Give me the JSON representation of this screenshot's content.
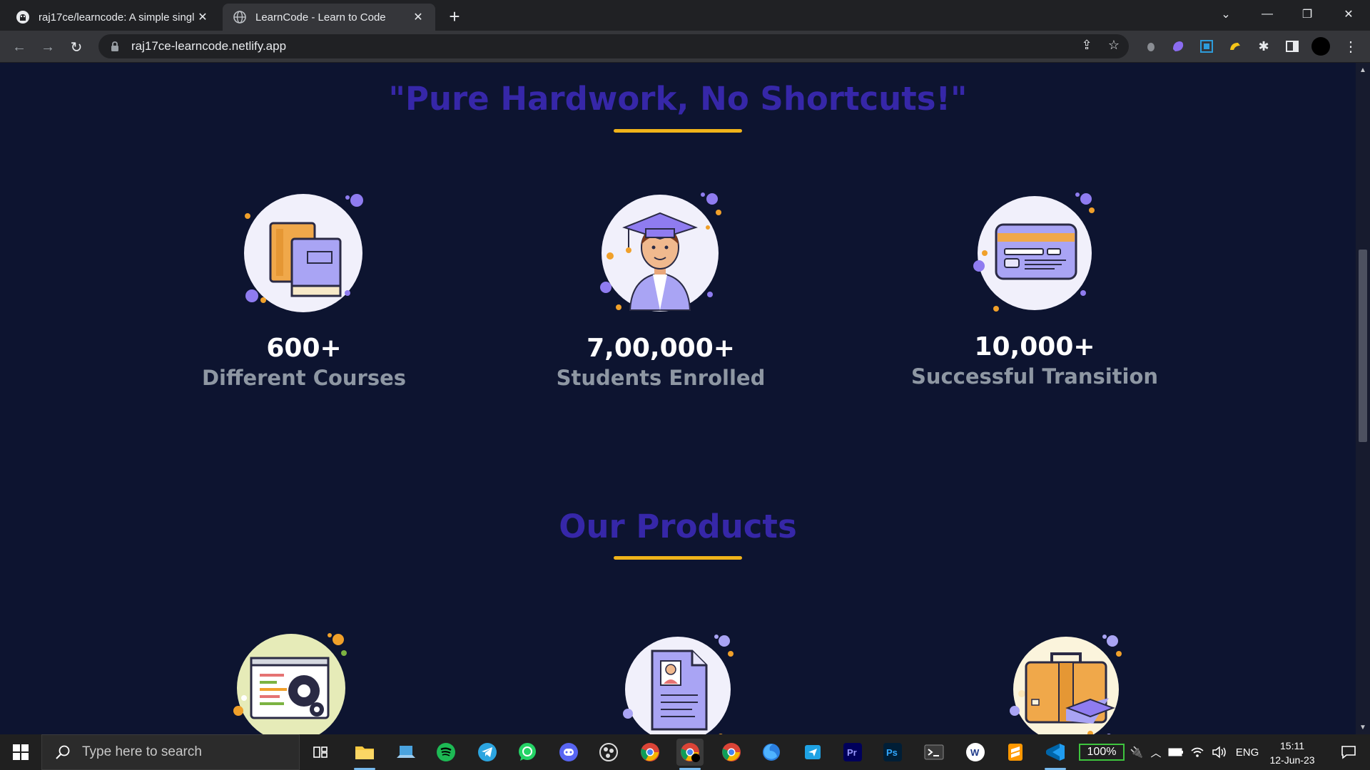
{
  "browser": {
    "tabs": [
      {
        "title": "raj17ce/learncode: A simple singl",
        "active": false,
        "icon": "github-icon"
      },
      {
        "title": "LearnCode - Learn to Code",
        "active": true,
        "icon": "globe-icon"
      }
    ],
    "url": "raj17ce-learncode.netlify.app"
  },
  "page": {
    "motto": "\"Pure Hardwork, No Shortcuts!\"",
    "stats": [
      {
        "number": "600+",
        "label": "Different Courses",
        "icon": "books-icon"
      },
      {
        "number": "7,00,000+",
        "label": "Students Enrolled",
        "icon": "graduate-student-icon"
      },
      {
        "number": "10,000+",
        "label": "Successful Transition",
        "icon": "credit-card-icon"
      }
    ],
    "products_title": "Our Products",
    "products": [
      {
        "icon": "code-settings-icon"
      },
      {
        "icon": "resume-icon"
      },
      {
        "icon": "briefcase-graduation-icon"
      }
    ]
  },
  "colors": {
    "background": "#0d1430",
    "heading": "#3627a8",
    "accent_underline": "#f0b31a",
    "stat_number": "#ffffff",
    "stat_label": "#8e97a3"
  },
  "taskbar": {
    "search_placeholder": "Type here to search",
    "battery": "100%",
    "language": "ENG",
    "time": "15:11",
    "date": "12-Jun-23"
  }
}
